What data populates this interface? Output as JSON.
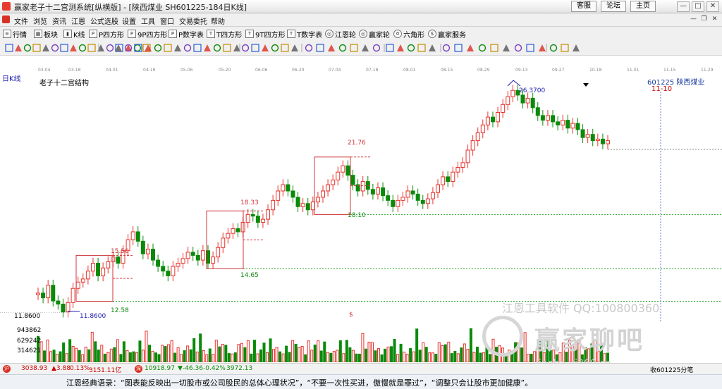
{
  "window": {
    "title": "赢家老子十二宫测系统[纵横版] - [陕西煤业  SH601225-184日K线]",
    "ext_buttons": [
      "客服",
      "论坛",
      "主页"
    ],
    "win_controls": [
      "—",
      "□",
      "✕"
    ],
    "mdi_controls": [
      "—",
      "❐",
      "✕"
    ]
  },
  "menu": [
    "文件",
    "浏览",
    "资讯",
    "江恩",
    "公式选股",
    "设置",
    "工具",
    "窗口",
    "交易委托",
    "帮助"
  ],
  "toolbar": [
    {
      "icon": "list-icon",
      "label": "行情"
    },
    {
      "icon": "grid-icon",
      "label": "板块"
    },
    {
      "icon": "candlestick-icon",
      "label": "K线"
    },
    {
      "icon": "p-square-icon",
      "label": "P四方形"
    },
    {
      "icon": "p-square-icon",
      "label": "9P四方形"
    },
    {
      "icon": "p-square-icon",
      "label": "P数字表"
    },
    {
      "icon": "t-square-icon",
      "label": "T四方形"
    },
    {
      "icon": "t-square-icon",
      "label": "9T四方形"
    },
    {
      "icon": "t-square-icon",
      "label": "T数字表"
    },
    {
      "icon": "wheel-icon",
      "label": "江恩轮"
    },
    {
      "icon": "wheel-icon",
      "label": "赢家轮"
    },
    {
      "icon": "star-icon",
      "label": "六角形"
    },
    {
      "icon": "dollar-icon",
      "label": "赢家服务"
    }
  ],
  "date_axis": [
    "03-04",
    "03-18",
    "04-01",
    "04-19",
    "05-06",
    "05-20",
    "06-06",
    "06-20",
    "07-04",
    "07-18",
    "08-01",
    "08-15",
    "08-29",
    "09-13",
    "09-27",
    "10-18",
    "11-01",
    "11-15",
    "11-29"
  ],
  "chart": {
    "period_label": "日K线",
    "title": "老子十二宫结构",
    "stock_code": "601225",
    "stock_name": "陕西煤业",
    "current_date": "11-10",
    "price_labels": [
      "15.50",
      "12.58",
      "18.33",
      "14.65",
      "21.76",
      "18.10",
      "11.8600",
      "26.3700"
    ],
    "left_axis_price": "11.8600",
    "marker": "$",
    "volume_axis": [
      "943862",
      "629242",
      "314621"
    ]
  },
  "chart_data": {
    "type": "candlestick",
    "boxes": [
      {
        "high": 15.5,
        "low": 12.58
      },
      {
        "high": 18.33,
        "low": 14.65
      },
      {
        "high": 21.76,
        "low": 18.1
      }
    ],
    "extremes": {
      "low": 11.86,
      "high": 26.37
    }
  },
  "watermarks": {
    "line1": "江恩工具软件  QQ:100800360",
    "line2": "赢家聊吧",
    "line3": "liaoba.yj360.cn"
  },
  "status": {
    "sh_value": "3038.93",
    "sh_change": "▲3.88",
    "sh_pct": "0.13%",
    "sh_amount": "3151.11亿",
    "sz_value": "10918.97",
    "sz_change": "▼-46.36",
    "sz_pct": "-0.42%",
    "sz_amount": "3972.13",
    "right_text": "收601225分笔"
  },
  "quote": "江恩经典语录：“图表能反映出一切股市或公司股民的总体心理状况”，“不要一次性买进，傲慢就是罪过”，“调整只会让股市更加健康”。",
  "colors": {
    "up": "#e8322c",
    "down": "#0a8a0a",
    "box": "#d0343a",
    "line": "#1a1ab0"
  }
}
